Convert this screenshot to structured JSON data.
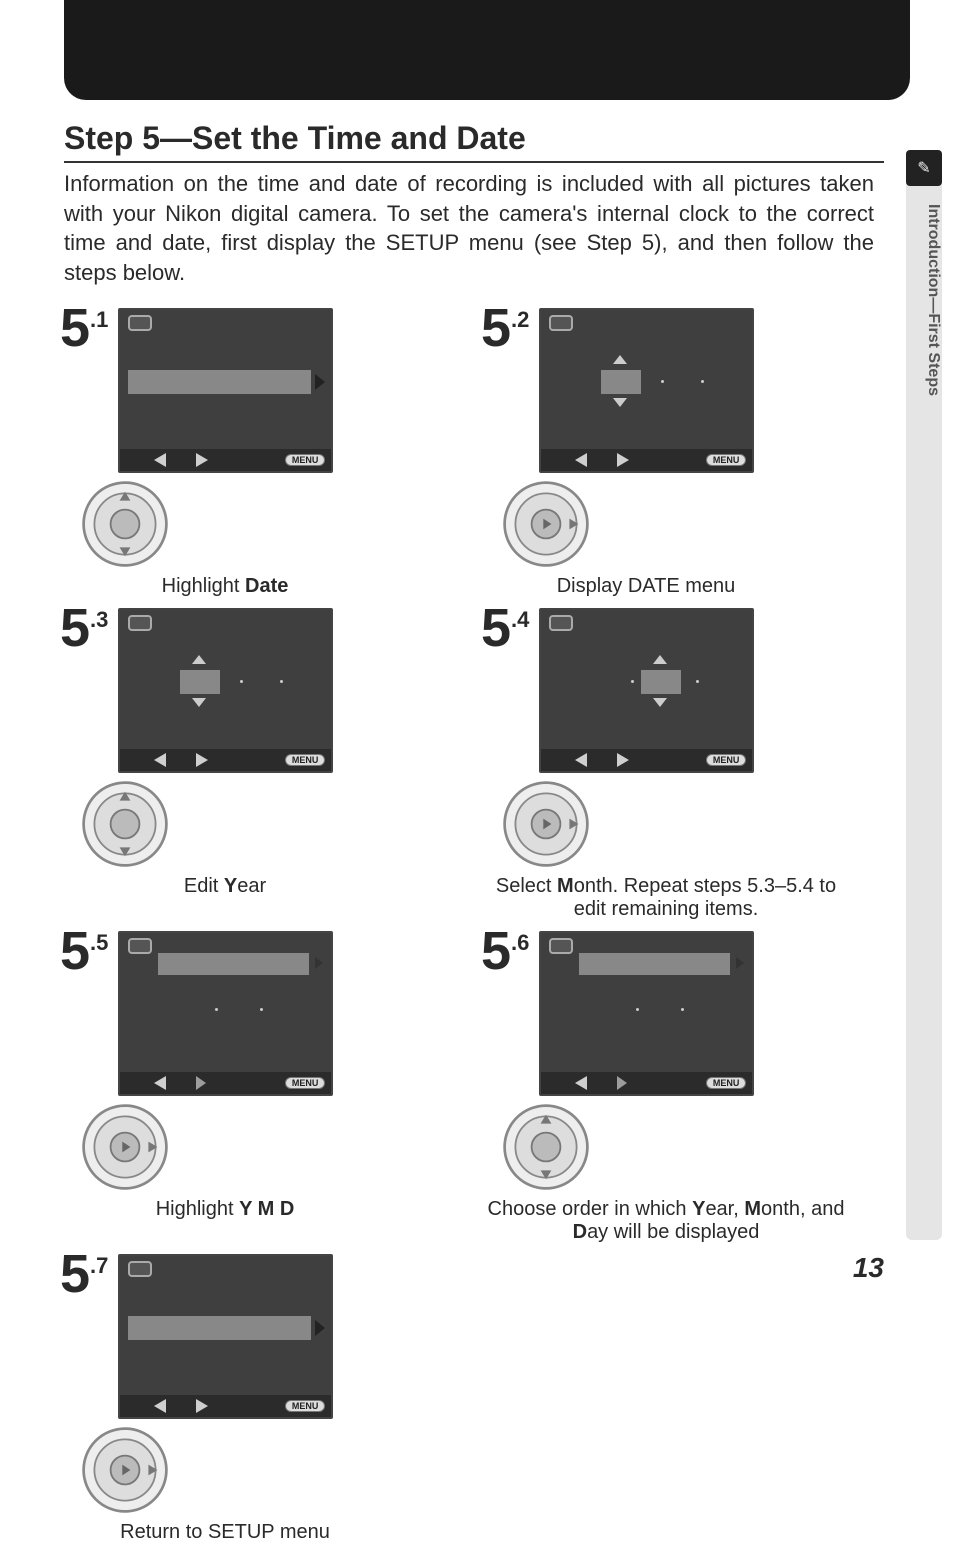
{
  "heading": "Step 5—Set the Time and Date",
  "intro": "Information on the time and date of recording is included with all pictures taken with your Nikon digital camera.  To set the camera's internal clock to the correct time and date, first display the SETUP menu (see Step 5), and then follow the steps below.",
  "steps": [
    {
      "num": "5",
      "sub": ".1",
      "caption_pre": "Highlight ",
      "caption_bold": "Date",
      "caption_post": ""
    },
    {
      "num": "5",
      "sub": ".2",
      "caption_pre": "Display DATE menu",
      "caption_bold": "",
      "caption_post": ""
    },
    {
      "num": "5",
      "sub": ".3",
      "caption_pre": "Edit ",
      "caption_bold": "Y",
      "caption_post": "ear"
    },
    {
      "num": "5",
      "sub": ".4",
      "caption_pre": "Select ",
      "caption_bold": "M",
      "caption_post": "onth.  Repeat steps 5.3–5.4 to edit remaining items."
    },
    {
      "num": "5",
      "sub": ".5",
      "caption_pre": "Highlight ",
      "caption_bold": "Y M D",
      "caption_post": ""
    },
    {
      "num": "5",
      "sub": ".6",
      "caption_pre": "Choose order in which ",
      "caption_bold": "Y",
      "caption_post": "ear, ",
      "caption_bold2": "M",
      "caption_post2": "onth, and ",
      "caption_bold3": "D",
      "caption_post3": "ay will be displayed"
    },
    {
      "num": "5",
      "sub": ".7",
      "caption_pre": "Return to SETUP menu",
      "caption_bold": "",
      "caption_post": ""
    }
  ],
  "menu_label": "MENU",
  "side_label": "Introduction—First Steps",
  "page_number": "13"
}
